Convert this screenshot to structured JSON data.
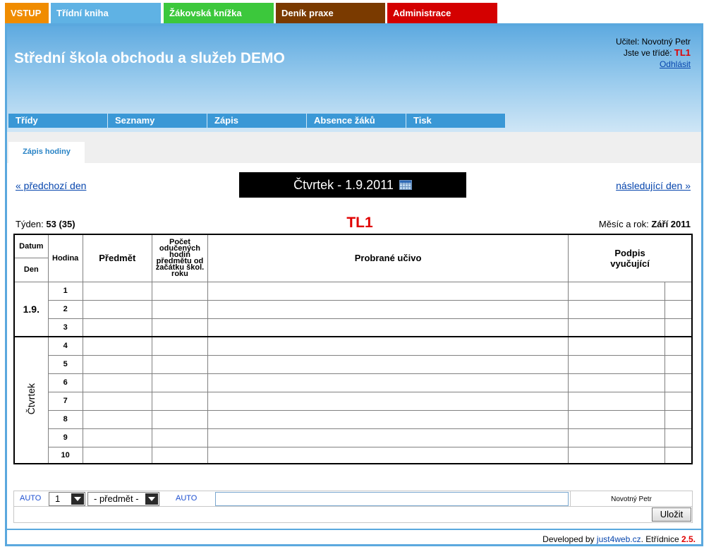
{
  "top_tabs": [
    {
      "label": "VSTUP",
      "color": "#f08c00"
    },
    {
      "label": "Třídní kniha",
      "color": "#5fb2e4"
    },
    {
      "label": "Žákovská knížka",
      "color": "#3cc83c"
    },
    {
      "label": "Deník praxe",
      "color": "#7a3a00"
    },
    {
      "label": "Administrace",
      "color": "#d40000"
    }
  ],
  "header": {
    "school_name": "Střední škola obchodu a služeb DEMO",
    "teacher_line": "Učitel: Novotný Petr",
    "class_label": "Jste ve třídě:",
    "class_value": "TL1",
    "logout": "Odhlásit"
  },
  "subnav": [
    "Třídy",
    "Seznamy",
    "Zápis",
    "Absence žáků",
    "Tisk"
  ],
  "page_tab": "Zápis hodiny",
  "nav": {
    "prev": "« předchozí den",
    "next": "následující den »",
    "current_date": "Čtvrtek - 1.9.2011"
  },
  "info": {
    "week_label": "Týden:",
    "week_value": "53 (35)",
    "class_code": "TL1",
    "month_label": "Měsíc a rok:",
    "month_value": "Září 2011"
  },
  "table": {
    "headers": {
      "datum": "Datum",
      "den": "Den",
      "hodina": "Hodina",
      "predmet": "Předmět",
      "pocet": "Počet odučených hodin předmětu od začátku škol. roku",
      "ucivo": "Probrané učivo",
      "podpis": "Podpis vyučující"
    },
    "day_date": "1.9.",
    "day_name": "Čtvrtek",
    "hours": [
      "1",
      "2",
      "3",
      "4",
      "5",
      "6",
      "7",
      "8",
      "9",
      "10"
    ]
  },
  "input_row": {
    "auto1": "AUTO",
    "hour_select": "1",
    "subject_select": "- předmět -",
    "auto2": "AUTO",
    "teacher": "Novotný Petr",
    "save": "Uložit"
  },
  "footer": {
    "prefix": "Developed by",
    "link": "just4web.cz",
    "suffix": ". Etřídnice",
    "version": "2.5."
  }
}
